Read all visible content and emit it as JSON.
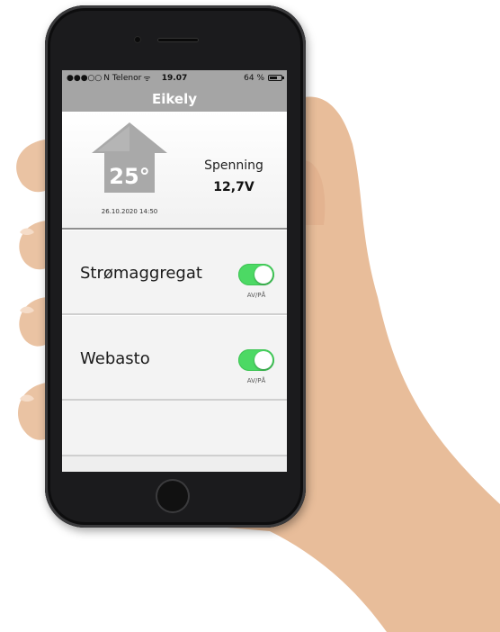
{
  "status_bar": {
    "carrier": "N Telenor",
    "time": "19.07",
    "battery": "64 %",
    "battery_level": 0.64
  },
  "nav": {
    "title": "Eikely"
  },
  "header": {
    "temperature": "25°",
    "timestamp": "26.10.2020 14:50",
    "voltage_label": "Spenning",
    "voltage_value": "12,7V"
  },
  "rows": [
    {
      "label": "Strømaggregat",
      "caption": "AV/PÅ",
      "on": true
    },
    {
      "label": "Webasto",
      "caption": "AV/PÅ",
      "on": true
    }
  ],
  "colors": {
    "toggle_on": "#4cd964",
    "header_bar": "#a5a5a5"
  }
}
